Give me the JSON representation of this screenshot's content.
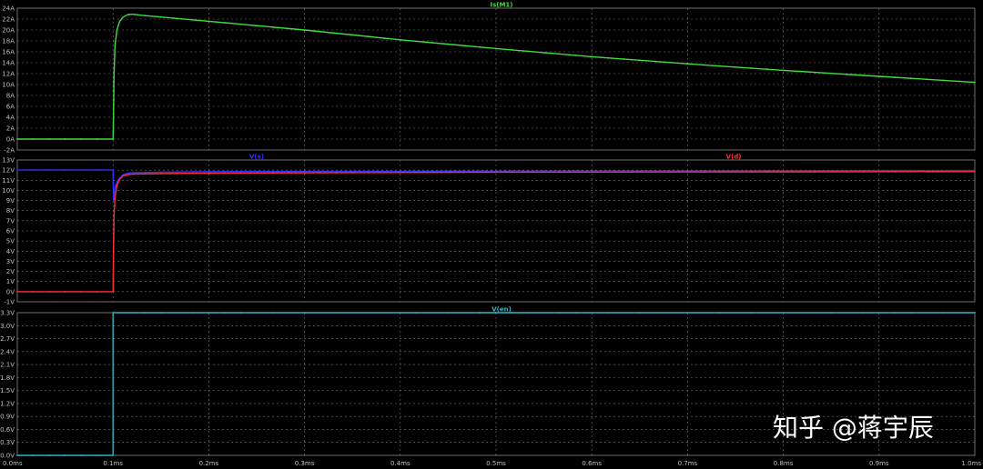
{
  "watermark": "知乎 @蒋宇辰",
  "colors": {
    "background": "#000000",
    "grid": "#7a7a7a",
    "frame": "#8a8a8a",
    "tick_text": "#bfbfbf"
  },
  "chart_data": [
    {
      "type": "line",
      "grid": true,
      "xlim": [
        0.0,
        1.0
      ],
      "x_ticks": [
        "0.0ms",
        "0.1ms",
        "0.2ms",
        "0.3ms",
        "0.4ms",
        "0.5ms",
        "0.6ms",
        "0.7ms",
        "0.8ms",
        "0.9ms",
        "1.0ms"
      ],
      "ylim": [
        -2,
        24
      ],
      "y_ticks": [
        "24A",
        "22A",
        "20A",
        "18A",
        "16A",
        "14A",
        "12A",
        "10A",
        "8A",
        "6A",
        "4A",
        "2A",
        "0A",
        "-2A"
      ],
      "series": [
        {
          "name": "Is(M1)",
          "color": "#3fdc3f",
          "x": [
            0,
            0.098,
            0.1,
            0.1005,
            0.101,
            0.102,
            0.104,
            0.107,
            0.11,
            0.115,
            0.12,
            0.125,
            0.13,
            0.2,
            0.3,
            0.4,
            0.5,
            0.6,
            0.7,
            0.8,
            0.9,
            1.0
          ],
          "y": [
            0,
            0,
            0,
            4,
            12,
            17,
            20,
            21.6,
            22.3,
            22.8,
            22.9,
            22.8,
            22.7,
            21.6,
            20.0,
            18.2,
            16.6,
            15.1,
            13.8,
            12.6,
            11.5,
            10.4
          ]
        }
      ]
    },
    {
      "type": "line",
      "grid": true,
      "xlim": [
        0.0,
        1.0
      ],
      "ylim": [
        -1,
        13
      ],
      "y_ticks": [
        "13V",
        "12V",
        "11V",
        "10V",
        "9V",
        "8V",
        "7V",
        "6V",
        "5V",
        "4V",
        "3V",
        "2V",
        "1V",
        "0V",
        "-1V"
      ],
      "series": [
        {
          "name": "V(s)",
          "color": "#3030ff",
          "x": [
            0,
            0.1,
            0.1005,
            0.102,
            0.105,
            0.11,
            0.115,
            0.12,
            0.15,
            0.2,
            0.5,
            1.0
          ],
          "y": [
            12,
            12,
            9,
            10.3,
            11.0,
            11.5,
            11.7,
            11.75,
            11.8,
            11.85,
            11.9,
            11.95
          ]
        },
        {
          "name": "V(d)",
          "color": "#ff3030",
          "x": [
            0,
            0.1,
            0.1005,
            0.101,
            0.102,
            0.104,
            0.107,
            0.11,
            0.115,
            0.12,
            0.15,
            0.2,
            0.5,
            1.0
          ],
          "y": [
            0,
            0,
            4,
            7.5,
            9.2,
            10.5,
            11.1,
            11.4,
            11.55,
            11.6,
            11.65,
            11.7,
            11.8,
            11.85
          ]
        }
      ]
    },
    {
      "type": "line",
      "grid": true,
      "xlim": [
        0.0,
        1.0
      ],
      "ylim": [
        0.0,
        3.3
      ],
      "y_ticks": [
        "3.3V",
        "3.0V",
        "2.7V",
        "2.4V",
        "2.1V",
        "1.8V",
        "1.5V",
        "1.2V",
        "0.9V",
        "0.6V",
        "0.3V",
        "0.0V"
      ],
      "series": [
        {
          "name": "V(en)",
          "color": "#2fb5c5",
          "x": [
            0,
            0.1,
            0.1,
            1.0
          ],
          "y": [
            0,
            0,
            3.3,
            3.3
          ]
        }
      ]
    }
  ]
}
